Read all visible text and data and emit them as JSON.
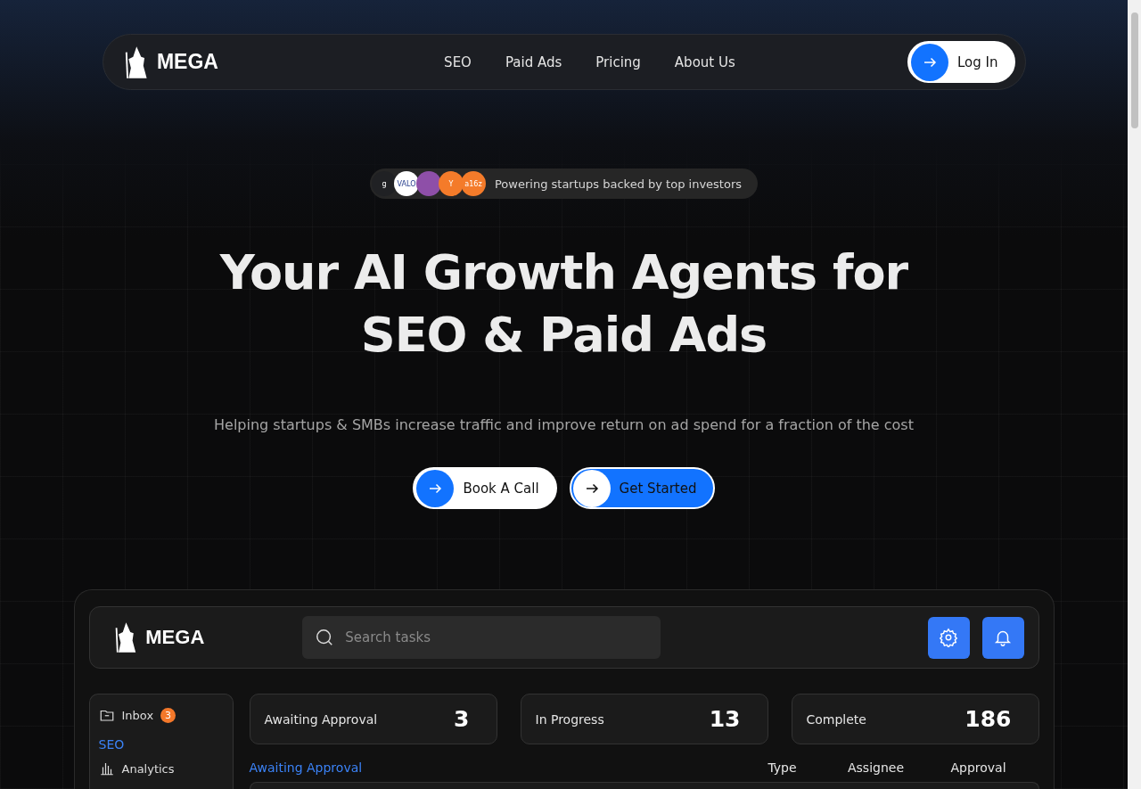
{
  "nav": {
    "brand": "MEGA",
    "links": [
      "SEO",
      "Paid Ads",
      "Pricing",
      "About Us"
    ],
    "login": "Log In"
  },
  "hero": {
    "investors": [
      {
        "mark": "g",
        "color": "#202124"
      },
      {
        "mark": "VALO",
        "color": "#ffffff"
      },
      {
        "color": "#8e4fa8"
      },
      {
        "mark": "Y",
        "color": "#f47b2a"
      },
      {
        "mark": "a16z",
        "color": "#f47b2a"
      }
    ],
    "badge": "Powering startups backed by top investors",
    "title_lines": [
      "Your AI Growth Agents for",
      "SEO & Paid Ads"
    ],
    "subtitle": "Helping startups & SMBs increase traffic and improve return on ad spend for a fraction of the cost",
    "buttons": [
      {
        "label": "Book A Call",
        "kind": "light"
      },
      {
        "label": "Get Started",
        "kind": "primary"
      }
    ]
  },
  "dashboard": {
    "brand": "MEGA",
    "search": {
      "placeholder": "Search tasks"
    },
    "sidebar": {
      "inbox": {
        "label": "Inbox",
        "count": "3"
      },
      "section": "SEO",
      "items": [
        "Analytics"
      ]
    },
    "stats": [
      {
        "label": "Awaiting Approval",
        "value": "3"
      },
      {
        "label": "In Progress",
        "value": "13"
      },
      {
        "label": "Complete",
        "value": "186"
      }
    ],
    "table": {
      "title": "Awaiting Approval",
      "columns": [
        "Type",
        "Assignee",
        "Approval"
      ]
    }
  }
}
